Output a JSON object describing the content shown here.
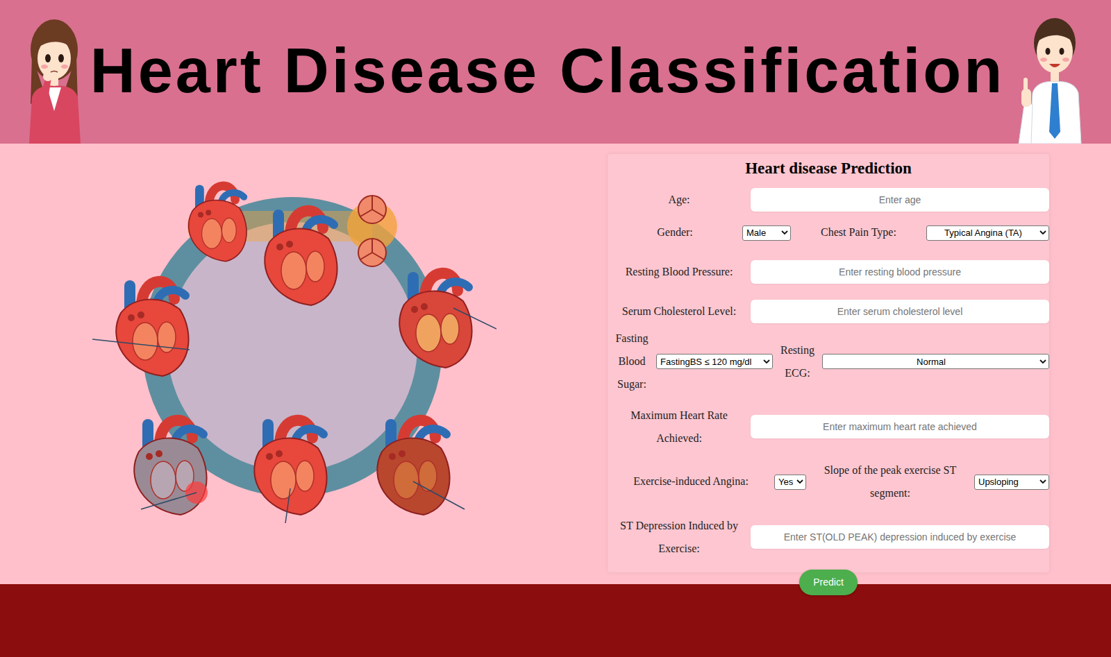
{
  "header": {
    "title": "Heart Disease Classification"
  },
  "form": {
    "title": "Heart disease Prediction",
    "age": {
      "label": "Age:",
      "placeholder": "Enter age"
    },
    "gender": {
      "label": "Gender:",
      "value": "Male"
    },
    "chest_pain": {
      "label": "Chest Pain Type:",
      "value": "Typical Angina (TA)"
    },
    "resting_bp": {
      "label": "Resting Blood Pressure:",
      "placeholder": "Enter resting blood pressure"
    },
    "cholesterol": {
      "label": "Serum Cholesterol Level:",
      "placeholder": "Enter serum cholesterol level"
    },
    "fasting_bs": {
      "label": "Fasting Blood Sugar:",
      "value": "FastingBS ≤ 120 mg/dl"
    },
    "resting_ecg": {
      "label": "Resting ECG:",
      "value": "Normal"
    },
    "max_hr": {
      "label": "Maximum Heart Rate Achieved:",
      "placeholder": "Enter maximum heart rate achieved"
    },
    "exercise_angina": {
      "label": "Exercise-induced Angina:",
      "value": "Yes"
    },
    "st_slope": {
      "label": "Slope of the peak exercise ST segment:",
      "value": "Upsloping"
    },
    "oldpeak": {
      "label": "ST Depression Induced by Exercise:",
      "placeholder": "Enter ST(OLD PEAK) depression induced by exercise"
    }
  },
  "button": "Predict"
}
